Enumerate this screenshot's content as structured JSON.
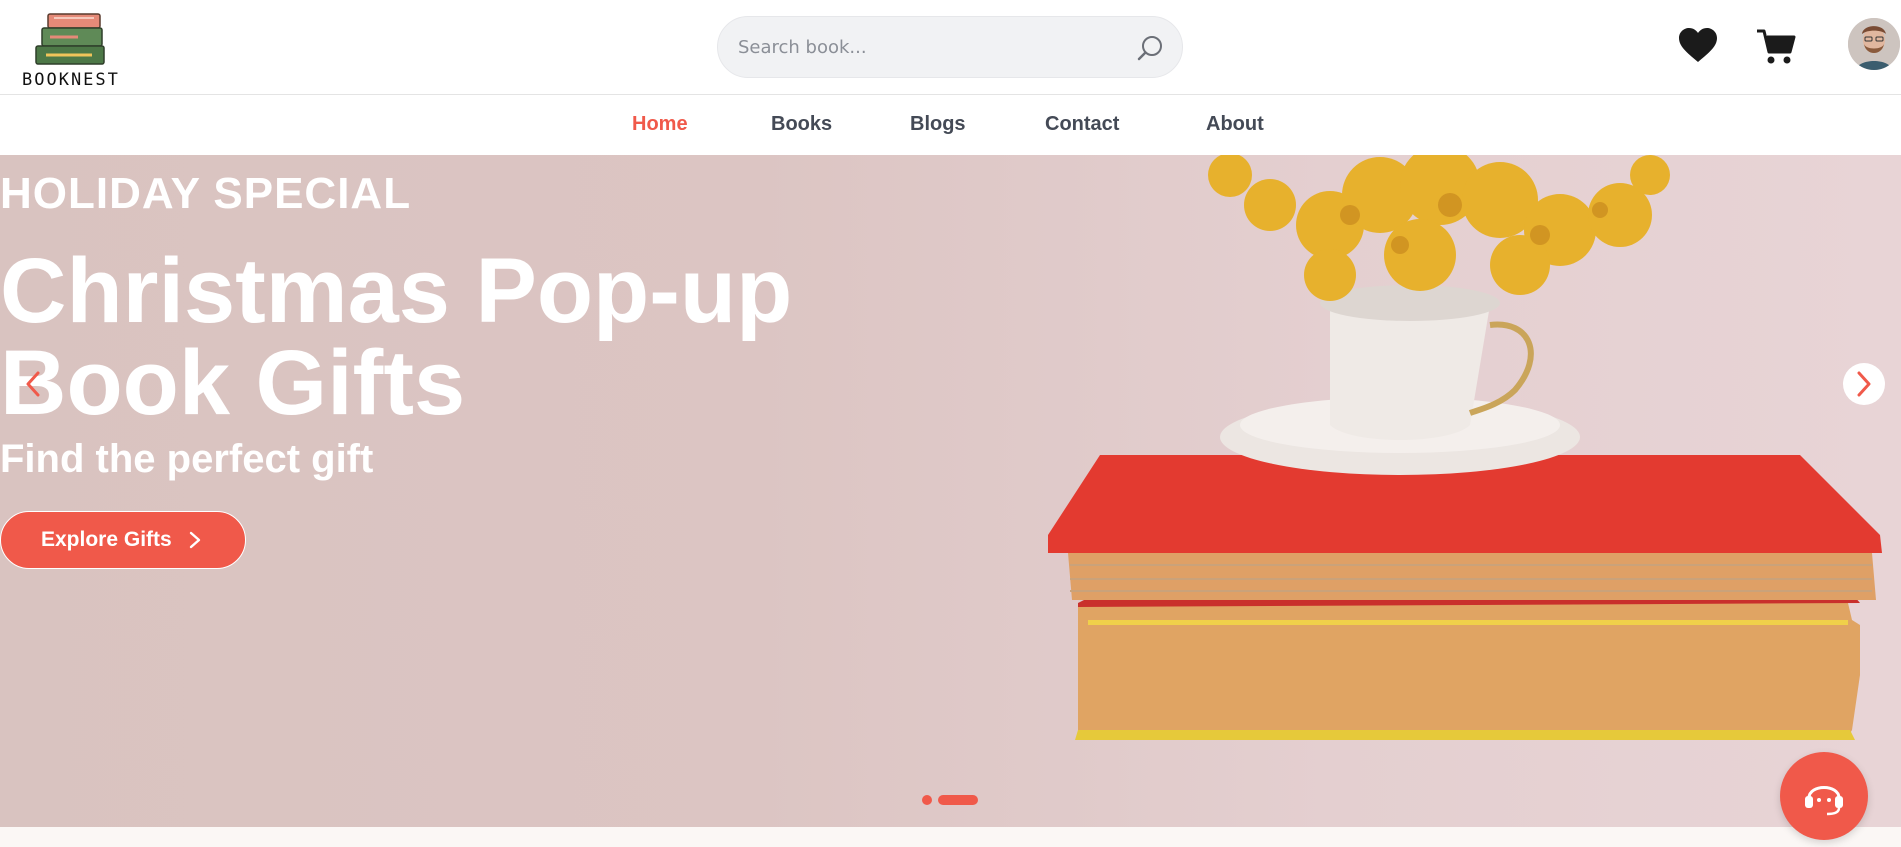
{
  "brand": {
    "name": "BOOKNEST"
  },
  "search": {
    "placeholder": "Search book..."
  },
  "header_icons": [
    "heart-icon",
    "cart-icon",
    "user-avatar"
  ],
  "nav": {
    "items": [
      {
        "label": "Home",
        "active": true
      },
      {
        "label": "Books",
        "active": false
      },
      {
        "label": "Blogs",
        "active": false
      },
      {
        "label": "Contact",
        "active": false
      },
      {
        "label": "About",
        "active": false
      }
    ]
  },
  "hero": {
    "eyebrow": "HOLIDAY SPECIAL",
    "headline": "Christmas Pop-up Book Gifts",
    "subhead": "Find the perfect gift",
    "cta_label": "Explore Gifts",
    "slides_total": 2,
    "active_slide": 2
  },
  "colors": {
    "accent": "#f0594a",
    "nav_text": "#444a56",
    "search_bg": "#f1f2f4"
  }
}
